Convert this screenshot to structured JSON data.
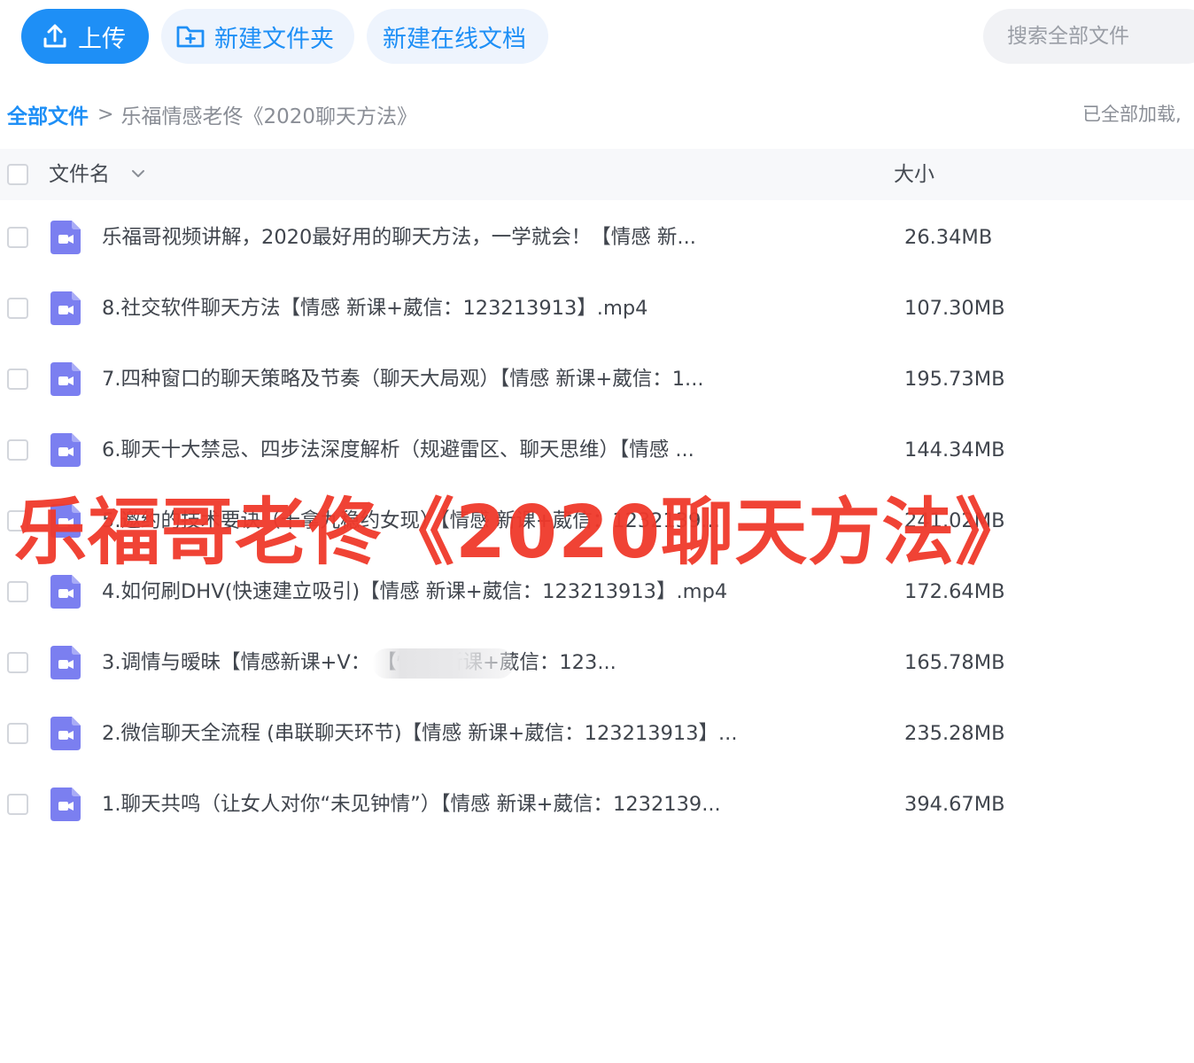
{
  "toolbar": {
    "upload_label": "上传",
    "new_folder_label": "新建文件夹",
    "new_doc_label": "新建在线文档",
    "search_placeholder": "搜索全部文件"
  },
  "breadcrumb": {
    "root": "全部文件",
    "separator": ">",
    "current": "乐福情感老佟《2020聊天方法》"
  },
  "status_text": "已全部加载,",
  "table": {
    "col_name": "文件名",
    "col_size": "大小",
    "rows": [
      {
        "name": "乐福哥视频讲解，2020最好用的聊天方法，一学就会！【情感 新...",
        "size": "26.34MB"
      },
      {
        "name": "8.社交软件聊天方法【情感 新课+葳信：123213913】.mp4",
        "size": "107.30MB"
      },
      {
        "name": "7.四种窗口的聊天策略及节奏（聊天大局观）【情感 新课+葳信：1...",
        "size": "195.73MB"
      },
      {
        "name": "6.聊天十大禁忌、四步法深度解析（规避雷区、聊天思维）【情感 ...",
        "size": "144.34MB"
      },
      {
        "name": "5.邀约的技术要诀（十拿九稳约女现）【情感 新课+葳信：1232139...",
        "size": "241.02MB"
      },
      {
        "name": "4.如何刷DHV(快速建立吸引)【情感 新课+葳信：123213913】.mp4",
        "size": "172.64MB"
      },
      {
        "name": "3.调情与暧昧【情感新课+V：                    【情感 新课+葳信：123...",
        "size": "165.78MB"
      },
      {
        "name": "2.微信聊天全流程 (串联聊天环节)【情感 新课+葳信：123213913】...",
        "size": "235.28MB"
      },
      {
        "name": "1.聊天共鸣（让女人对你“未见钟情”）【情感 新课+葳信：1232139...",
        "size": "394.67MB"
      }
    ]
  },
  "watermark_text": "乐福哥老佟《2020聊天方法》",
  "colors": {
    "accent": "#1e8ff6",
    "video_icon": "#7b7ff0",
    "watermark": "#f0392b"
  },
  "icons": {
    "upload": "upload-icon",
    "new_folder": "folder-plus-icon",
    "sort": "chevron-down-icon",
    "file": "video-file-icon"
  }
}
